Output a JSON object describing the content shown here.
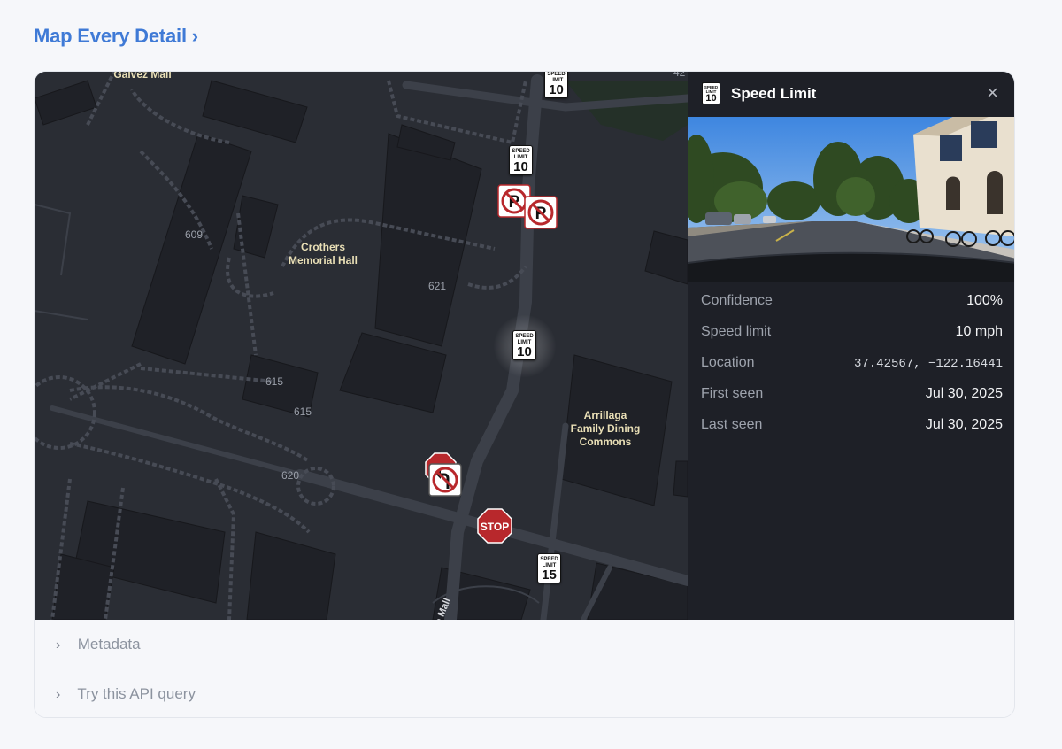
{
  "heading": "Map Every Detail ›",
  "map": {
    "buildings": [
      {
        "name": "Galvez Mall"
      },
      {
        "name": "Crothers\nMemorial Hall"
      },
      {
        "name": "Arrillaga\nFamily Dining\nCommons"
      }
    ],
    "numbers": [
      "609",
      "621",
      "615",
      "615",
      "620",
      "42"
    ],
    "street": "o Mall",
    "signs": {
      "speed_text": "SPEED\nLIMIT",
      "speed_values": [
        "10",
        "10",
        "10",
        "15"
      ],
      "stop_text": "STOP",
      "no_parking_text": "P"
    }
  },
  "panel": {
    "icon_text": "SPEED\nLIMIT",
    "icon_value": "10",
    "title": "Speed Limit",
    "close": "×",
    "rows": [
      {
        "label": "Confidence",
        "value": "100%"
      },
      {
        "label": "Speed limit",
        "value": "10 mph"
      },
      {
        "label": "Location",
        "value": "37.42567, −122.16441"
      },
      {
        "label": "First seen",
        "value": "Jul 30, 2025"
      },
      {
        "label": "Last seen",
        "value": "Jul 30, 2025"
      }
    ]
  },
  "footer": {
    "metadata": "Metadata",
    "api_query": "Try this API query",
    "chevron": "›"
  },
  "colors": {
    "accent": "#3f7ad6",
    "map_bg": "#2a2d34",
    "building": "#1f2127",
    "panel_bg": "#1e2027",
    "stop_red": "#b8282c"
  }
}
